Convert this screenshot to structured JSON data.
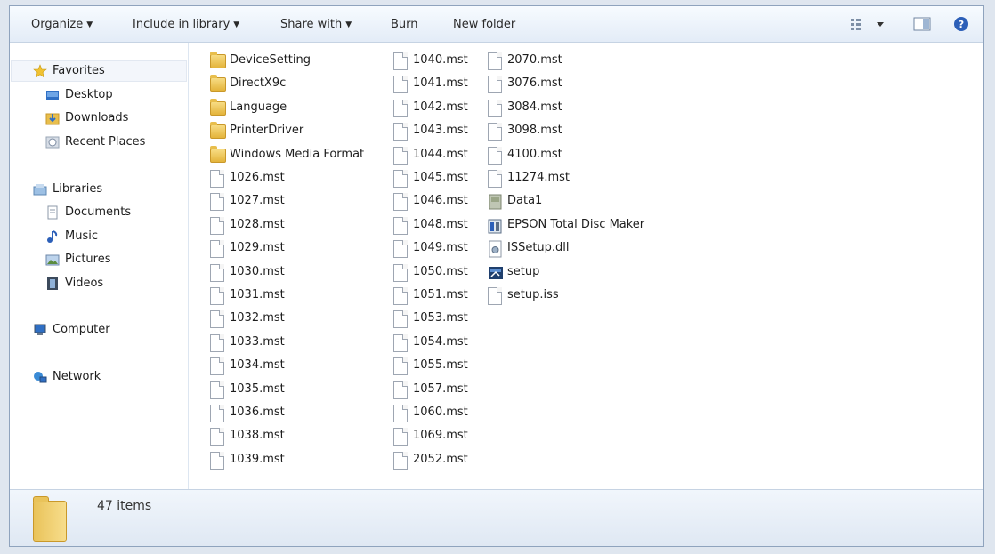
{
  "toolbar": {
    "organize": "Organize",
    "include": "Include in library",
    "share": "Share with",
    "burn": "Burn",
    "new_folder": "New folder"
  },
  "nav": {
    "favorites": "Favorites",
    "desktop": "Desktop",
    "downloads": "Downloads",
    "recent": "Recent Places",
    "libraries": "Libraries",
    "documents": "Documents",
    "music": "Music",
    "pictures": "Pictures",
    "videos": "Videos",
    "computer": "Computer",
    "network": "Network"
  },
  "files": [
    {
      "name": "DeviceSetting",
      "type": "folder"
    },
    {
      "name": "DirectX9c",
      "type": "folder"
    },
    {
      "name": "Language",
      "type": "folder"
    },
    {
      "name": "PrinterDriver",
      "type": "folder"
    },
    {
      "name": "Windows Media Format",
      "type": "folder"
    },
    {
      "name": "1026.mst",
      "type": "file"
    },
    {
      "name": "1027.mst",
      "type": "file"
    },
    {
      "name": "1028.mst",
      "type": "file"
    },
    {
      "name": "1029.mst",
      "type": "file"
    },
    {
      "name": "1030.mst",
      "type": "file"
    },
    {
      "name": "1031.mst",
      "type": "file"
    },
    {
      "name": "1032.mst",
      "type": "file"
    },
    {
      "name": "1033.mst",
      "type": "file"
    },
    {
      "name": "1034.mst",
      "type": "file"
    },
    {
      "name": "1035.mst",
      "type": "file"
    },
    {
      "name": "1036.mst",
      "type": "file"
    },
    {
      "name": "1038.mst",
      "type": "file"
    },
    {
      "name": "1039.mst",
      "type": "file"
    },
    {
      "name": "1040.mst",
      "type": "file"
    },
    {
      "name": "1041.mst",
      "type": "file"
    },
    {
      "name": "1042.mst",
      "type": "file"
    },
    {
      "name": "1043.mst",
      "type": "file"
    },
    {
      "name": "1044.mst",
      "type": "file"
    },
    {
      "name": "1045.mst",
      "type": "file"
    },
    {
      "name": "1046.mst",
      "type": "file"
    },
    {
      "name": "1048.mst",
      "type": "file"
    },
    {
      "name": "1049.mst",
      "type": "file"
    },
    {
      "name": "1050.mst",
      "type": "file"
    },
    {
      "name": "1051.mst",
      "type": "file"
    },
    {
      "name": "1053.mst",
      "type": "file"
    },
    {
      "name": "1054.mst",
      "type": "file"
    },
    {
      "name": "1055.mst",
      "type": "file"
    },
    {
      "name": "1057.mst",
      "type": "file"
    },
    {
      "name": "1060.mst",
      "type": "file"
    },
    {
      "name": "1069.mst",
      "type": "file"
    },
    {
      "name": "2052.mst",
      "type": "file"
    },
    {
      "name": "2070.mst",
      "type": "file"
    },
    {
      "name": "3076.mst",
      "type": "file"
    },
    {
      "name": "3084.mst",
      "type": "file"
    },
    {
      "name": "3098.mst",
      "type": "file"
    },
    {
      "name": "4100.mst",
      "type": "file"
    },
    {
      "name": "11274.mst",
      "type": "file"
    },
    {
      "name": "Data1",
      "type": "cab"
    },
    {
      "name": "EPSON Total Disc Maker",
      "type": "installer"
    },
    {
      "name": "ISSetup.dll",
      "type": "dll"
    },
    {
      "name": "setup",
      "type": "exe"
    },
    {
      "name": "setup.iss",
      "type": "file"
    }
  ],
  "status": {
    "item_count": "47 items"
  }
}
